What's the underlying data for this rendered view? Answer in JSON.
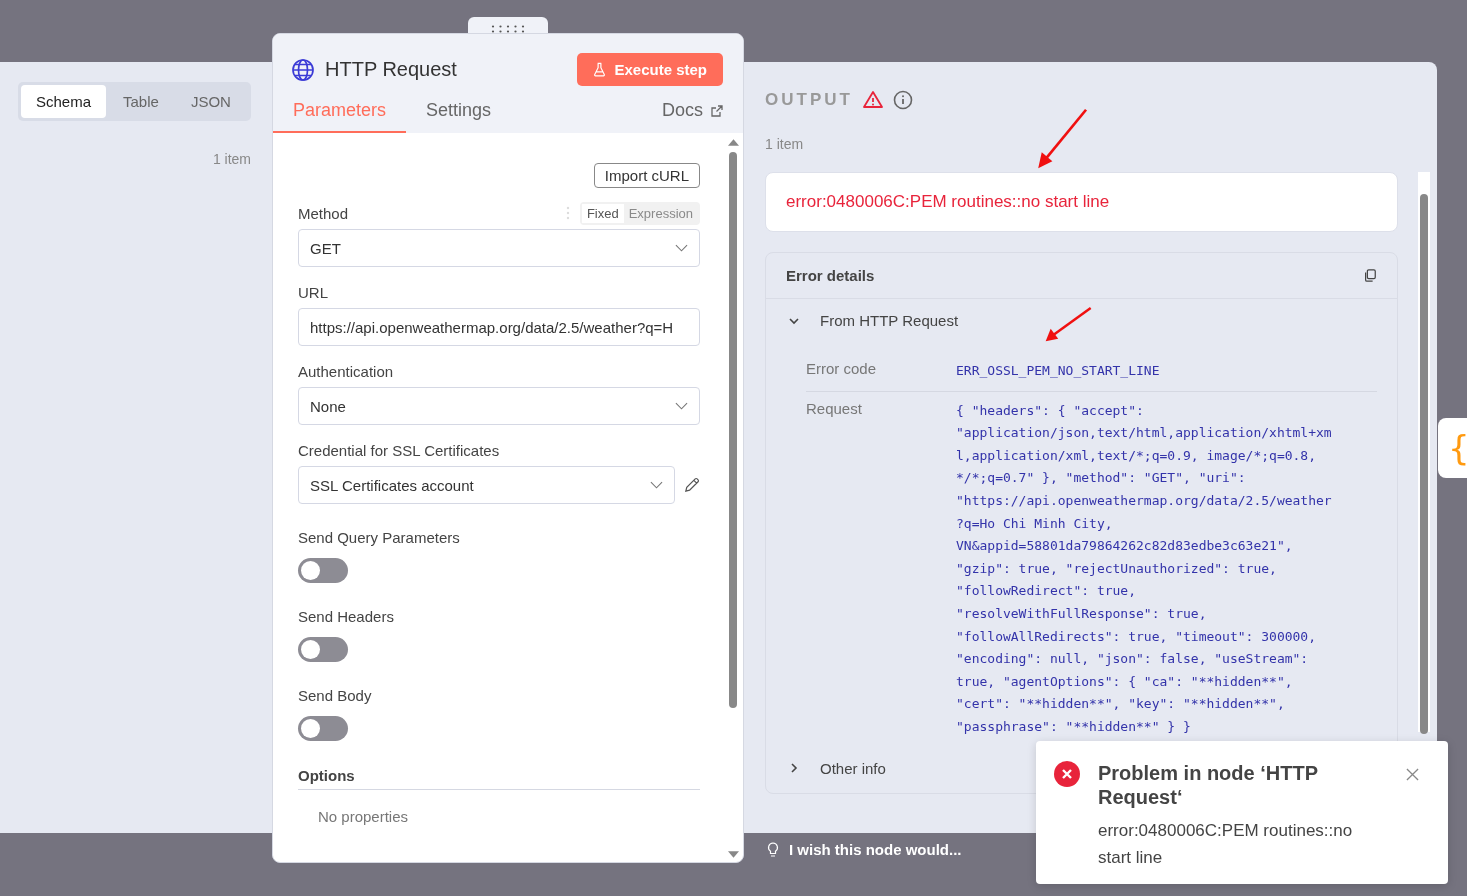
{
  "input_panel": {
    "view_tabs": [
      {
        "label": "Schema",
        "selected": true
      },
      {
        "label": "Table",
        "selected": false
      },
      {
        "label": "JSON",
        "selected": false
      }
    ],
    "item_count": "1 item"
  },
  "node": {
    "title": "HTTP Request",
    "execute_button": "Execute step",
    "tabs": [
      {
        "label": "Parameters",
        "selected": true
      },
      {
        "label": "Settings",
        "selected": false
      }
    ],
    "docs_link": "Docs",
    "import_button": "Import cURL",
    "mode_options": [
      {
        "label": "Fixed",
        "selected": true
      },
      {
        "label": "Expression",
        "selected": false
      }
    ],
    "fields": [
      {
        "kind": "select",
        "label": "Method",
        "value": "GET"
      },
      {
        "kind": "text",
        "label": "URL",
        "value": "https://api.openweathermap.org/data/2.5/weather?q=H"
      },
      {
        "kind": "select",
        "label": "Authentication",
        "value": "None"
      },
      {
        "kind": "credential",
        "label": "Credential for SSL Certificates",
        "value": "SSL Certificates account"
      },
      {
        "kind": "toggle",
        "label": "Send Query Parameters",
        "on": false
      },
      {
        "kind": "toggle",
        "label": "Send Headers",
        "on": false
      },
      {
        "kind": "toggle",
        "label": "Send Body",
        "on": false
      }
    ],
    "options": {
      "title": "Options",
      "empty": "No properties"
    }
  },
  "output": {
    "title": "OUTPUT",
    "item_count": "1 item",
    "error_message": "error:0480006C:PEM routines::no start line",
    "details": {
      "title": "Error details",
      "source": "From HTTP Request",
      "expanded": true,
      "rows": [
        {
          "label": "Error code",
          "value": "ERR_OSSL_PEM_NO_START_LINE"
        },
        {
          "label": "Request",
          "value": "{ \"headers\": { \"accept\": \"application/json,text/html,application/xhtml+xml,application/xml,text/*;q=0.9, image/*;q=0.8, */*;q=0.7\" }, \"method\": \"GET\", \"uri\": \"https://api.openweathermap.org/data/2.5/weather?q=Ho Chi Minh City, VN&appid=58801da79864262c82d83edbe3c63e21\", \"gzip\": true, \"rejectUnauthorized\": true, \"followRedirect\": true, \"resolveWithFullResponse\": true, \"followAllRedirects\": true, \"timeout\": 300000, \"encoding\": null, \"json\": false, \"useStream\": true, \"agentOptions\": { \"ca\": \"**hidden**\", \"cert\": \"**hidden**\", \"key\": \"**hidden**\", \"passphrase\": \"**hidden**\" } }"
        }
      ],
      "other": {
        "label": "Other info",
        "expanded": false
      }
    }
  },
  "feedback": "I wish this node would...",
  "side_tab": "{",
  "toast": {
    "title": "Problem in node ‘HTTP Request‘",
    "message": "error:0480006C:PEM routines::no start line"
  }
}
